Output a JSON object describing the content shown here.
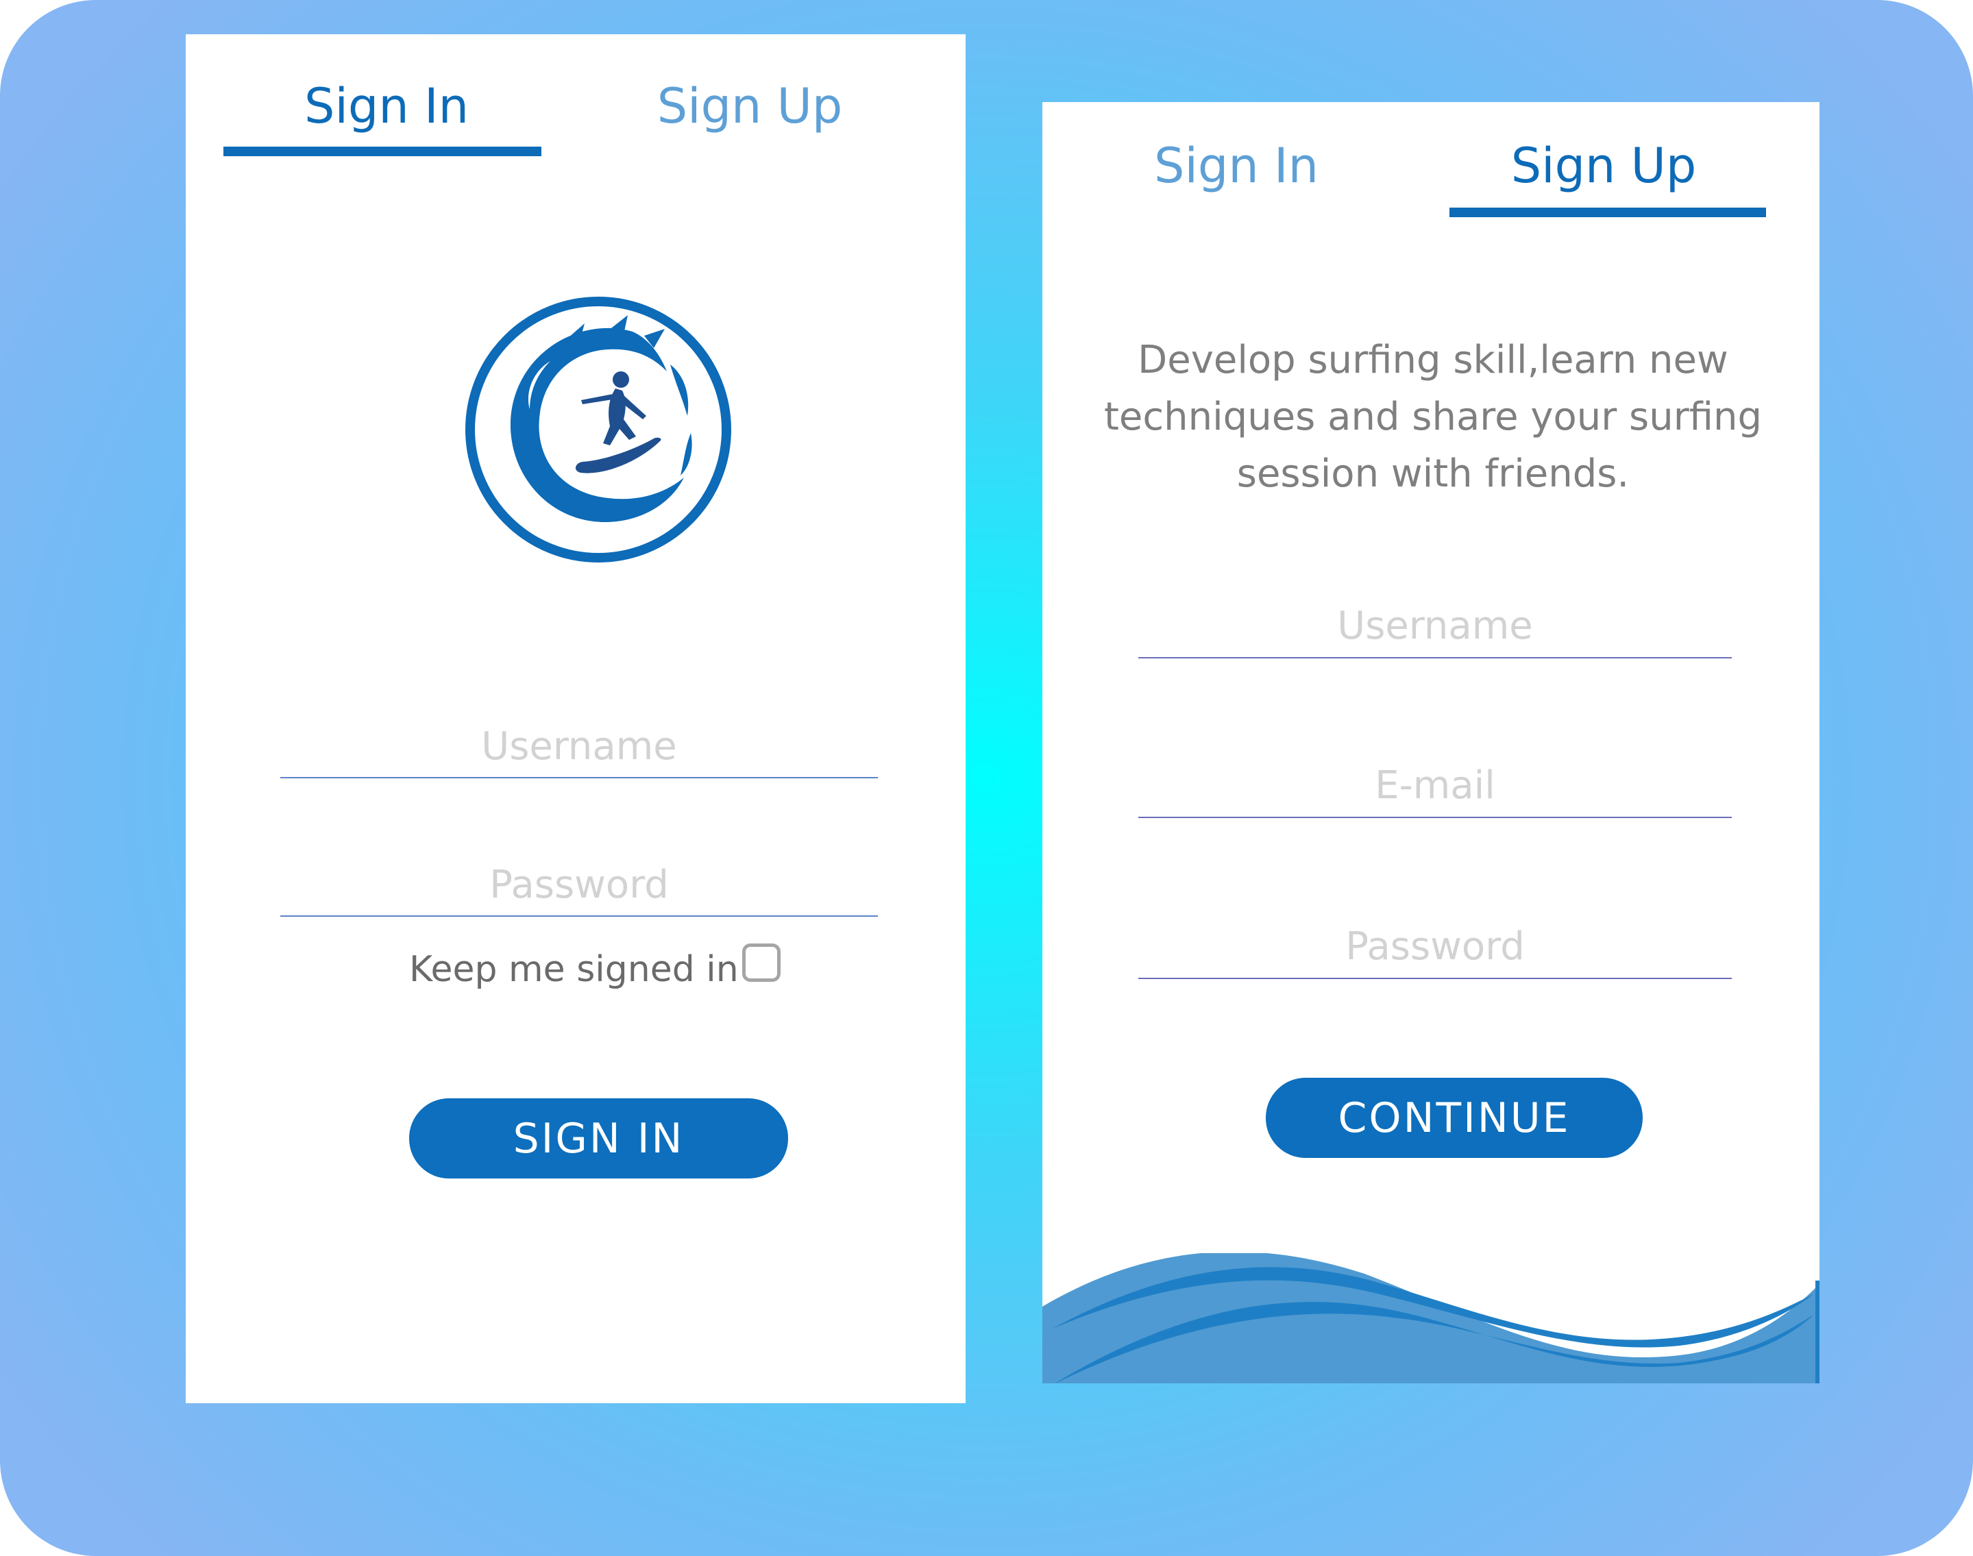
{
  "colors": {
    "accent": "#0d6fbd",
    "tab_active": "#0d6bb8",
    "tab_inactive": "#5ea0d6",
    "wave_light": "#4f9ad2",
    "wave_dark": "#1f7fc6",
    "background_center": "#00ffff",
    "background_edge": "#86b6f3"
  },
  "sign_in_screen": {
    "tabs": [
      {
        "label": "Sign In",
        "active": true
      },
      {
        "label": "Sign Up",
        "active": false
      }
    ],
    "logo": {
      "icon": "surfer-wave-logo"
    },
    "username": {
      "placeholder": "Username",
      "value": ""
    },
    "password": {
      "placeholder": "Password",
      "value": ""
    },
    "keep_signed_in": {
      "label": "Keep me signed in",
      "checked": false
    },
    "submit_label": "SIGN IN"
  },
  "sign_up_screen": {
    "tabs": [
      {
        "label": "Sign In",
        "active": false
      },
      {
        "label": "Sign Up",
        "active": true
      }
    ],
    "intro_text": "Develop surfing skill,learn new techniques and share your surfing session with friends.",
    "username": {
      "placeholder": "Username",
      "value": ""
    },
    "email": {
      "placeholder": "E-mail",
      "value": ""
    },
    "password": {
      "placeholder": "Password",
      "value": ""
    },
    "submit_label": "CONTINUE",
    "decoration": {
      "icon": "ocean-waves"
    }
  }
}
